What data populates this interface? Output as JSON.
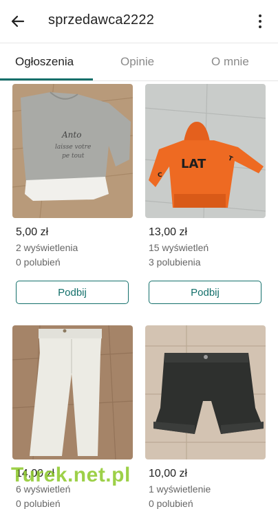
{
  "header": {
    "title": "sprzedawca2222"
  },
  "tabs": [
    {
      "label": "Ogłoszenia",
      "active": true
    },
    {
      "label": "Opinie",
      "active": false
    },
    {
      "label": "O mnie",
      "active": false
    }
  ],
  "listings": [
    {
      "price": "5,00 zł",
      "views": "2 wyświetlenia",
      "likes": "0 polubień",
      "button": "Podbij"
    },
    {
      "price": "13,00 zł",
      "views": "15 wyświetleń",
      "likes": "3 polubienia",
      "button": "Podbij"
    },
    {
      "price": "14,00 zł",
      "views": "6 wyświetleń",
      "likes": "0 polubień"
    },
    {
      "price": "10,00 zł",
      "views": "1 wyświetlenie",
      "likes": "0 polubień"
    }
  ],
  "watermark": "Turek.net.pl",
  "colors": {
    "accent": "#126f6a",
    "watermark": "#8cc828"
  }
}
